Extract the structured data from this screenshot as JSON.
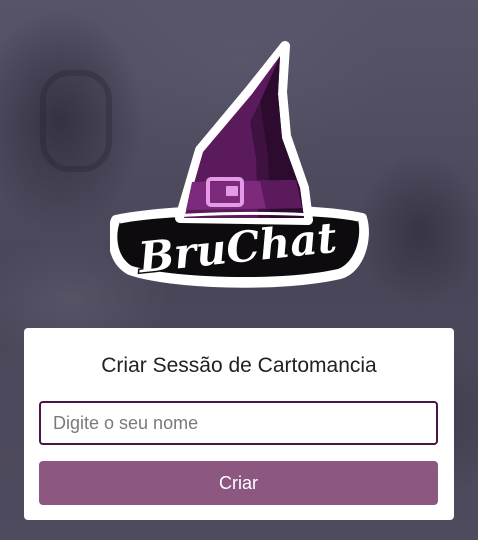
{
  "brand": {
    "logo_text": "BruChat"
  },
  "form": {
    "title": "Criar Sessão de Cartomancia",
    "name_placeholder": "Digite o seu nome",
    "name_value": "",
    "submit_label": "Criar"
  },
  "colors": {
    "hat_purple": "#5a1a5c",
    "accent_pink": "#e39be8",
    "button_bg": "#8c5882",
    "input_border": "#4a1446"
  }
}
